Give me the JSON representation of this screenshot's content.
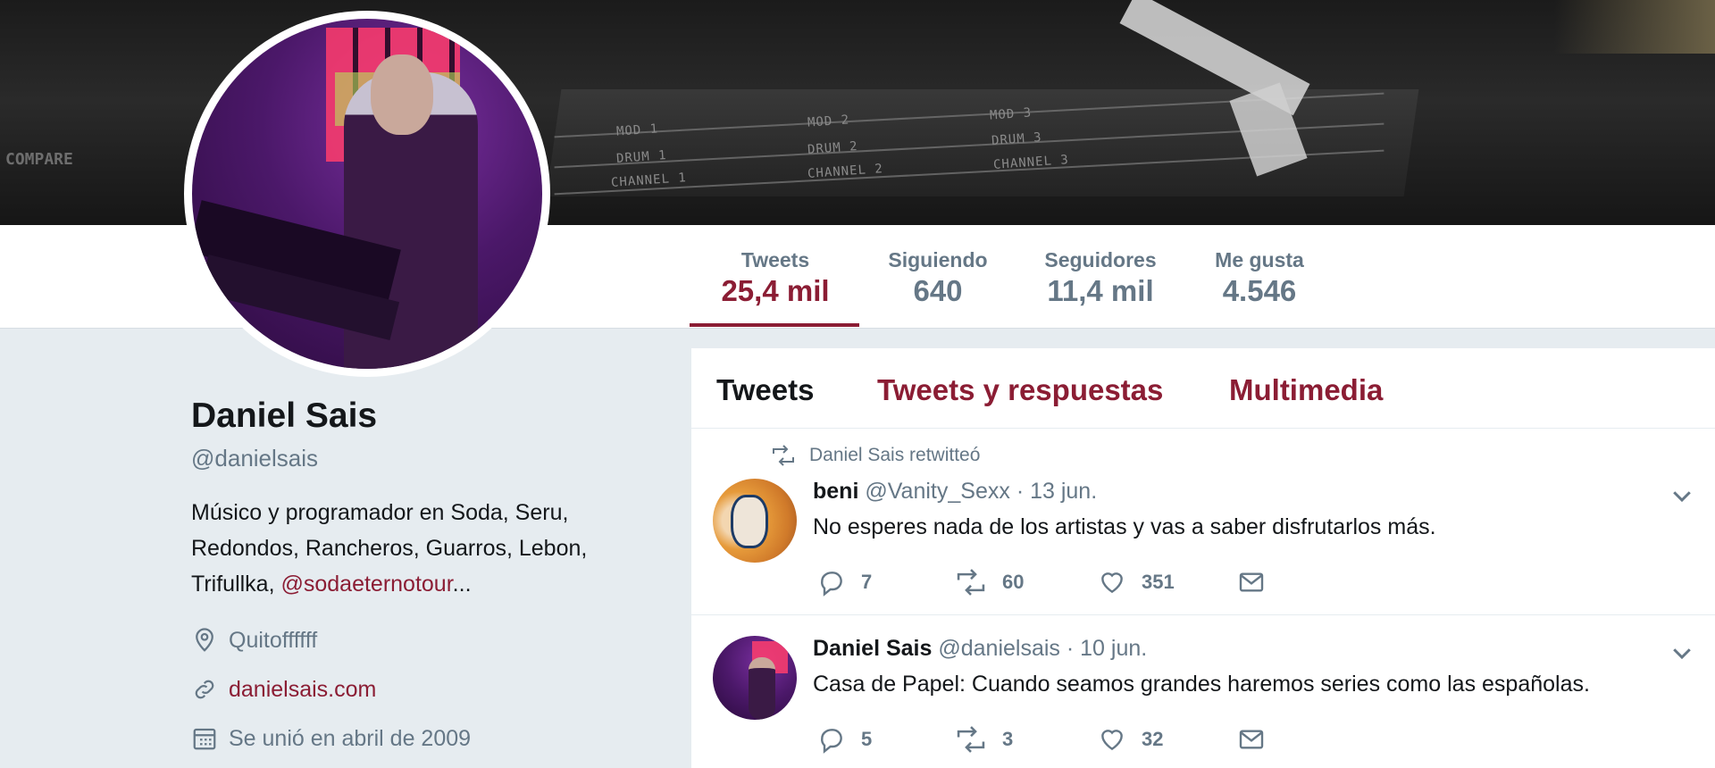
{
  "banner": {
    "labels": [
      "MOD 1",
      "MOD 2",
      "MOD 3",
      "DRUM 1",
      "DRUM 2",
      "DRUM 3",
      "CHANNEL 1",
      "CHANNEL 2",
      "CHANNEL 3"
    ],
    "compare": "COMPARE"
  },
  "stats": [
    {
      "label": "Tweets",
      "value": "25,4 mil"
    },
    {
      "label": "Siguiendo",
      "value": "640"
    },
    {
      "label": "Seguidores",
      "value": "11,4 mil"
    },
    {
      "label": "Me gusta",
      "value": "4.546"
    }
  ],
  "profile": {
    "name": "Daniel Sais",
    "handle": "@danielsais",
    "bio_text": "Músico y programador en Soda, Seru, Redondos, Rancheros, Guarros, Lebon, Trifullka, ",
    "bio_link": "@sodaeternotour",
    "bio_ellipsis": "...",
    "location": "Quitoffffff",
    "website": "danielsais.com",
    "joined": "Se unió en abril de 2009"
  },
  "tabs": [
    {
      "label": "Tweets"
    },
    {
      "label": "Tweets y respuestas"
    },
    {
      "label": "Multimedia"
    }
  ],
  "tweets": [
    {
      "retweet_note": "Daniel Sais retwitteó",
      "name": "beni",
      "handle": "@Vanity_Sexx",
      "date": "· 13 jun.",
      "text": "No esperes nada de los artistas y vas a saber disfrutarlos más.",
      "replies": "7",
      "retweets": "60",
      "likes": "351"
    },
    {
      "name": "Daniel Sais",
      "handle": "@danielsais",
      "date": "· 10 jun.",
      "text": "Casa de Papel: Cuando seamos grandes haremos series como las españolas.",
      "replies": "5",
      "retweets": "3",
      "likes": "32"
    }
  ],
  "colors": {
    "accent": "#8b1d34",
    "muted": "#657786",
    "background": "#e6ecf0"
  },
  "icons": [
    "map-pin-icon",
    "link-icon",
    "calendar-icon",
    "retweet-icon",
    "reply-icon",
    "like-icon",
    "message-icon",
    "chevron-down-icon"
  ]
}
